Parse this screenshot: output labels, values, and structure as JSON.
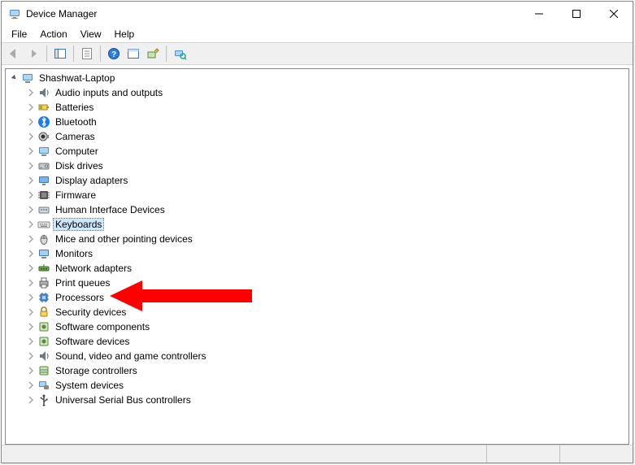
{
  "window": {
    "title": "Device Manager"
  },
  "menu": [
    "File",
    "Action",
    "View",
    "Help"
  ],
  "root": {
    "label": "Shashwat-Laptop"
  },
  "devices": [
    {
      "label": "Audio inputs and outputs",
      "icon": "audio"
    },
    {
      "label": "Batteries",
      "icon": "battery"
    },
    {
      "label": "Bluetooth",
      "icon": "bluetooth"
    },
    {
      "label": "Cameras",
      "icon": "camera"
    },
    {
      "label": "Computer",
      "icon": "computer"
    },
    {
      "label": "Disk drives",
      "icon": "disk"
    },
    {
      "label": "Display adapters",
      "icon": "display"
    },
    {
      "label": "Firmware",
      "icon": "firmware"
    },
    {
      "label": "Human Interface Devices",
      "icon": "hid"
    },
    {
      "label": "Keyboards",
      "icon": "keyboard",
      "selected": true
    },
    {
      "label": "Mice and other pointing devices",
      "icon": "mouse"
    },
    {
      "label": "Monitors",
      "icon": "monitor"
    },
    {
      "label": "Network adapters",
      "icon": "network"
    },
    {
      "label": "Print queues",
      "icon": "printer"
    },
    {
      "label": "Processors",
      "icon": "processor"
    },
    {
      "label": "Security devices",
      "icon": "security"
    },
    {
      "label": "Software components",
      "icon": "software"
    },
    {
      "label": "Software devices",
      "icon": "software"
    },
    {
      "label": "Sound, video and game controllers",
      "icon": "audio"
    },
    {
      "label": "Storage controllers",
      "icon": "storage"
    },
    {
      "label": "System devices",
      "icon": "system"
    },
    {
      "label": "Universal Serial Bus controllers",
      "icon": "usb"
    }
  ]
}
